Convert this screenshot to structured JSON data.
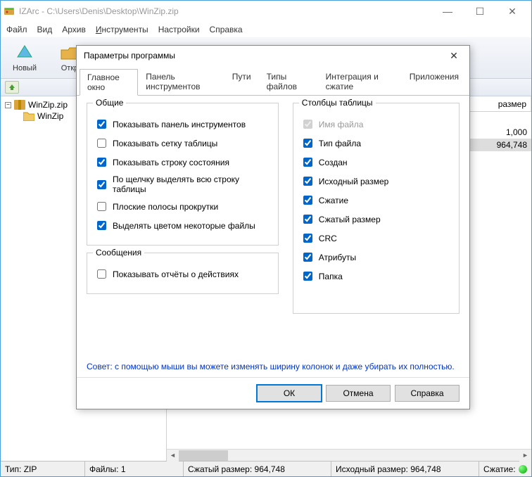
{
  "titlebar": {
    "text": "IZArc - C:\\Users\\Denis\\Desktop\\WinZip.zip"
  },
  "menubar": {
    "file": "Файл",
    "view": "Вид",
    "archive": "Архив",
    "tools": "Инструменты",
    "tools_u": "И",
    "tools_rest": "нструменты",
    "settings": "Настройки",
    "help": "Справка"
  },
  "toolbar": {
    "new": "Новый",
    "open": "Откр"
  },
  "tree": {
    "root": "WinZip.zip",
    "child": "WinZip"
  },
  "list": {
    "header_size": "размер",
    "val1": "1,000",
    "val2": "964,748"
  },
  "statusbar": {
    "type_label": "Тип:",
    "type_val": "ZIP",
    "files_label": "Файлы:",
    "files_val": "1",
    "packed_label": "Сжатый размер:",
    "packed_val": "964,748",
    "orig_label": "Исходный размер:",
    "orig_val": "964,748",
    "compress_label": "Сжатие:"
  },
  "dialog": {
    "title": "Параметры программы",
    "tabs": {
      "main": "Главное окно",
      "toolbar": "Панель инструментов",
      "paths": "Пути",
      "filetypes": "Типы файлов",
      "integration": "Интеграция и сжатие",
      "apps": "Приложения"
    },
    "group_general": "Общие",
    "chk_show_toolbar": "Показывать панель инструментов",
    "chk_show_grid": "Показывать сетку таблицы",
    "chk_show_status": "Показывать строку состояния",
    "chk_click_row": "По щелчку выделять всю строку таблицы",
    "chk_flat_scroll": "Плоские полосы прокрутки",
    "chk_highlight": "Выделять цветом некоторые файлы",
    "group_messages": "Сообщения",
    "chk_reports": "Показывать отчёты о действиях",
    "group_columns": "Столбцы таблицы",
    "chk_filename": "Имя файла",
    "chk_filetype": "Тип файла",
    "chk_created": "Создан",
    "chk_origsize": "Исходный размер",
    "chk_compression": "Сжатие",
    "chk_packedsize": "Сжатый размер",
    "chk_crc": "CRC",
    "chk_attrs": "Атрибуты",
    "chk_folder": "Папка",
    "hint": "Совет: с помощью мыши вы можете изменять ширину колонок и даже убирать их полностью.",
    "btn_ok": "ОК",
    "btn_cancel": "Отмена",
    "btn_help": "Справка"
  }
}
